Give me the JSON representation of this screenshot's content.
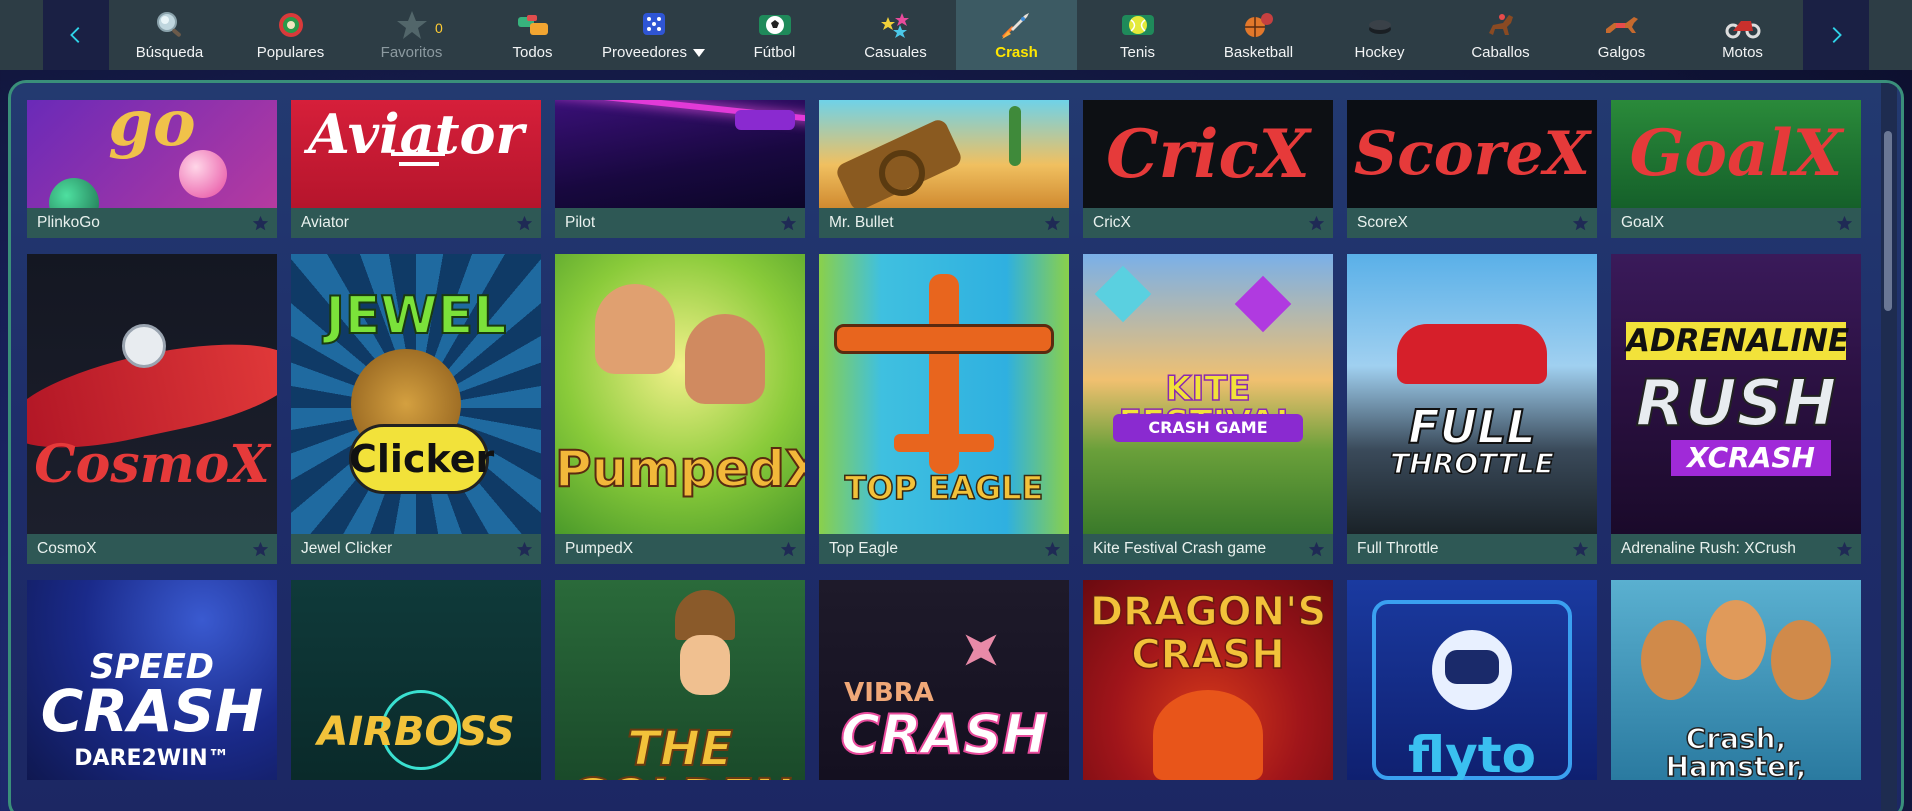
{
  "nav": {
    "items": [
      {
        "label": "Búsqueda",
        "icon": "search-icon"
      },
      {
        "label": "Populares",
        "icon": "popular-badge-icon"
      },
      {
        "label": "Favoritos",
        "icon": "star-icon",
        "count": "0"
      },
      {
        "label": "Todos",
        "icon": "all-games-icon"
      },
      {
        "label": "Proveedores",
        "icon": "dice-icon"
      },
      {
        "label": "Fútbol",
        "icon": "football-icon"
      },
      {
        "label": "Casuales",
        "icon": "stars-icon"
      },
      {
        "label": "Crash",
        "icon": "rocket-icon"
      },
      {
        "label": "Tenis",
        "icon": "tennis-icon"
      },
      {
        "label": "Basketball",
        "icon": "basketball-icon"
      },
      {
        "label": "Hockey",
        "icon": "hockey-puck-icon"
      },
      {
        "label": "Caballos",
        "icon": "horse-icon"
      },
      {
        "label": "Galgos",
        "icon": "greyhound-icon"
      },
      {
        "label": "Motos",
        "icon": "motorbike-icon"
      }
    ],
    "active": "Crash"
  },
  "games": {
    "row1": [
      {
        "title": "PlinkoGo",
        "art": "go"
      },
      {
        "title": "Aviator",
        "art": "Aviator"
      },
      {
        "title": "Pilot",
        "art": ""
      },
      {
        "title": "Mr. Bullet",
        "art": ""
      },
      {
        "title": "CricX",
        "art": "CricX"
      },
      {
        "title": "ScoreX",
        "art": "ScoreX"
      },
      {
        "title": "GoalX",
        "art": "GoalX"
      }
    ],
    "row2": [
      {
        "title": "CosmoX",
        "art": "CosmoX"
      },
      {
        "title": "Jewel Clicker",
        "art": "JEWEL",
        "art2": "Clicker"
      },
      {
        "title": "PumpedX",
        "art": "PumpedX"
      },
      {
        "title": "Top Eagle",
        "art": "TOP EAGLE"
      },
      {
        "title": "Kite Festival Crash game",
        "art": "KITE FESTIVAL",
        "art2": "CRASH GAME"
      },
      {
        "title": "Full Throttle",
        "art": "FULL",
        "art2": "THROTTLE"
      },
      {
        "title": "Adrenaline Rush: XCrush",
        "art": "ADRENALINE",
        "art2": "RUSH",
        "art3": "XCRASH"
      }
    ],
    "row3": [
      {
        "art": "SPEED",
        "art2": "CRASH",
        "art3": "DARE2WIN™"
      },
      {
        "art": "AIRBOSS"
      },
      {
        "art": "THE GOLDEN"
      },
      {
        "art": "VIBRA",
        "art2": "CRASH"
      },
      {
        "art": "DRAGON'S",
        "art2": "CRASH"
      },
      {
        "art": "flyto"
      },
      {
        "art": "Crash, Hamster,"
      }
    ]
  },
  "colors": {
    "nav_bg": "#2d3d45",
    "active_tab": "#3c5a63",
    "active_label": "#ffe600",
    "caption_bg": "#2e5855",
    "panel_border": "#3a8f7a"
  }
}
